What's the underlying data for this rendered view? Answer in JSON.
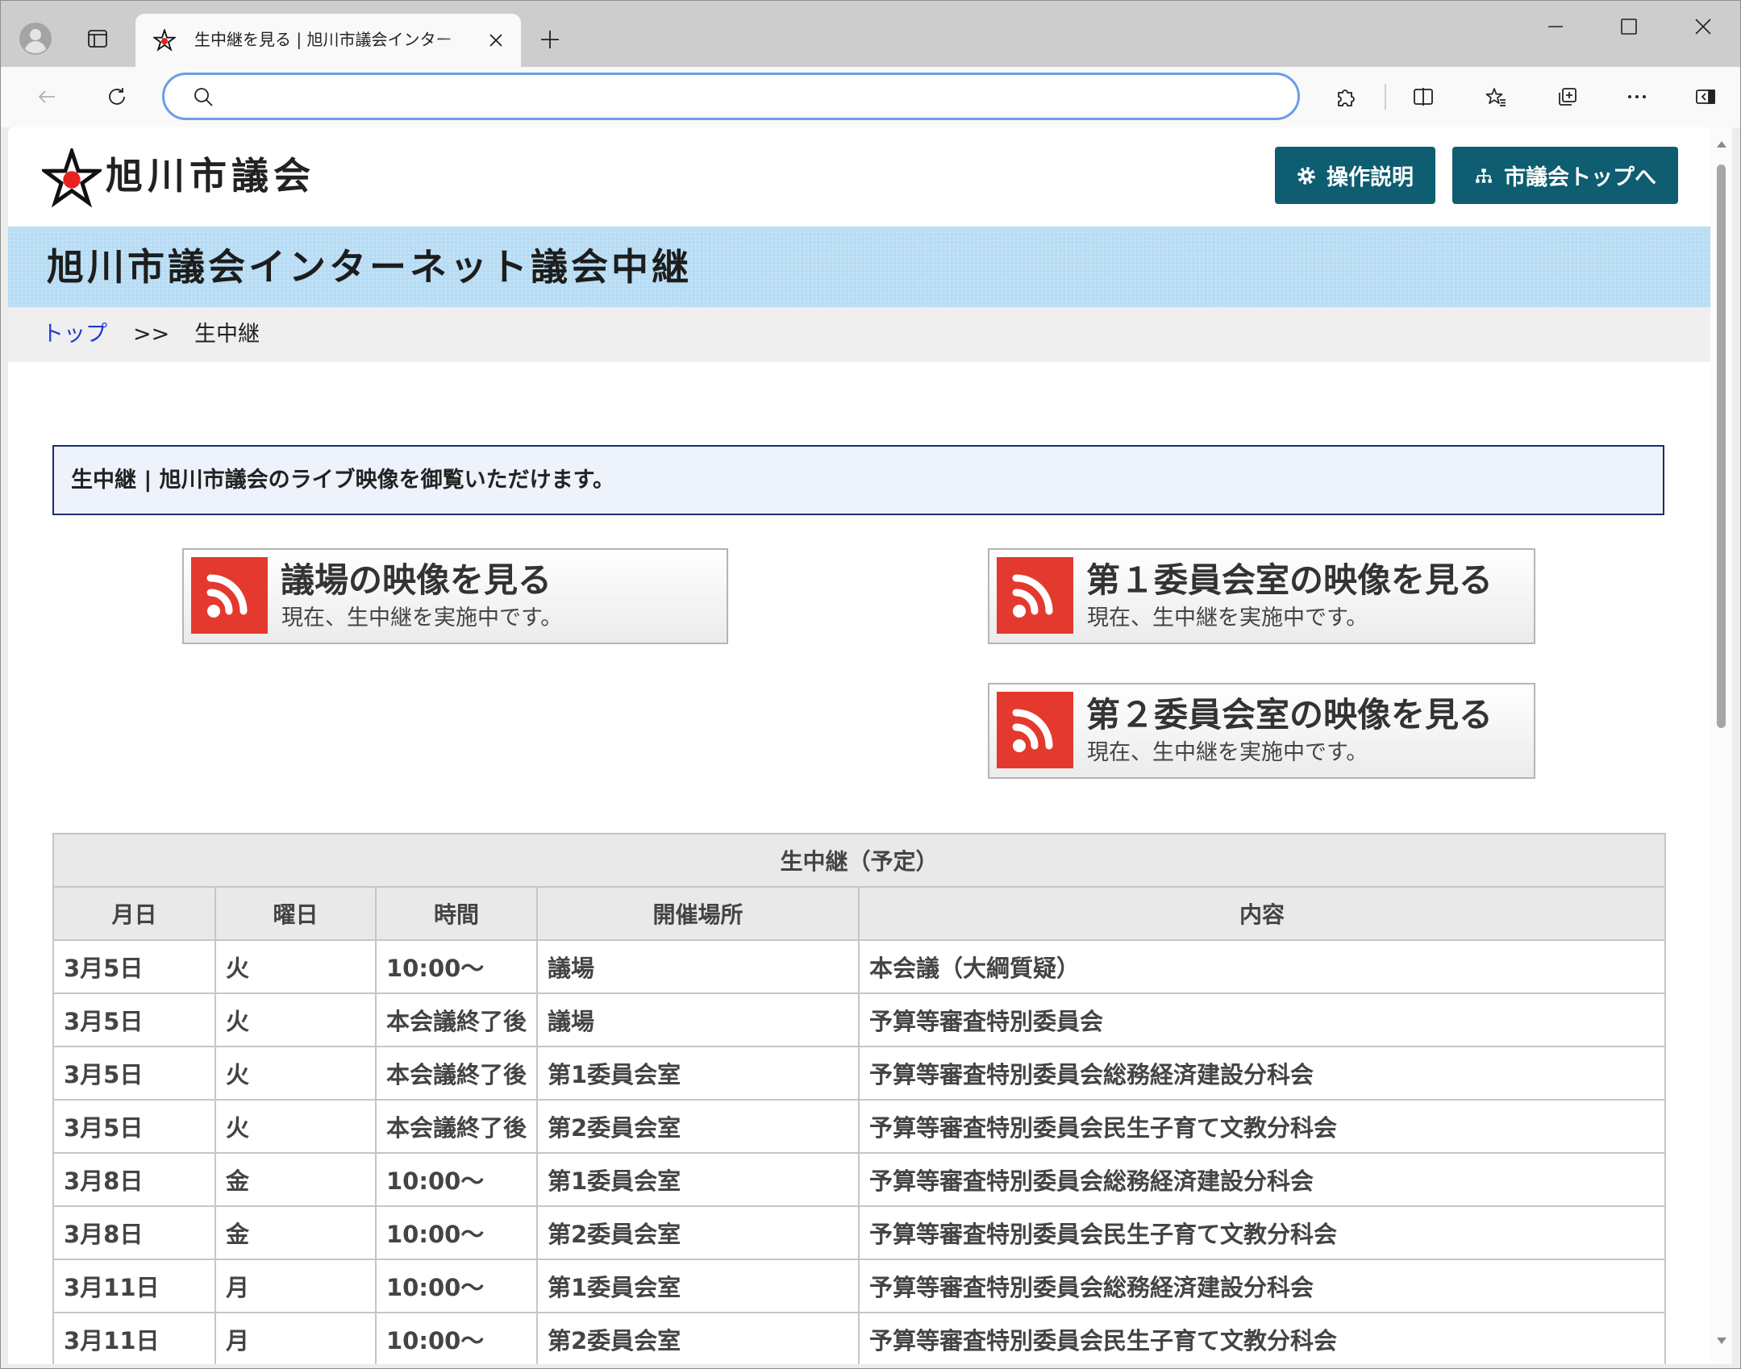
{
  "browser": {
    "tab": {
      "title": "生中継を見る | 旭川市議会インター"
    },
    "address_bar": {
      "value": ""
    }
  },
  "site": {
    "logo_text": "旭川市議会",
    "help_button_label": "操作説明",
    "top_button_label": "市議会トップへ",
    "banner_title": "旭川市議会インターネット議会中継"
  },
  "breadcrumb": {
    "home": "トップ",
    "separator": ">>",
    "current": "生中継"
  },
  "notice": "生中継 | 旭川市議会のライブ映像を御覧いただけます。",
  "live_links": [
    {
      "title": "議場の映像を見る",
      "status": "現在、生中継を実施中です。"
    },
    {
      "title": "第１委員会室の映像を見る",
      "status": "現在、生中継を実施中です。"
    },
    {
      "title": "第２委員会室の映像を見る",
      "status": "現在、生中継を実施中です。"
    }
  ],
  "schedule": {
    "caption": "生中継（予定）",
    "columns": [
      "月日",
      "曜日",
      "時間",
      "開催場所",
      "内容"
    ],
    "rows": [
      [
        "3月5日",
        "火",
        "10:00～",
        "議場",
        "本会議（大綱質疑）"
      ],
      [
        "3月5日",
        "火",
        "本会議終了後",
        "議場",
        "予算等審査特別委員会"
      ],
      [
        "3月5日",
        "火",
        "本会議終了後",
        "第1委員会室",
        "予算等審査特別委員会総務経済建設分科会"
      ],
      [
        "3月5日",
        "火",
        "本会議終了後",
        "第2委員会室",
        "予算等審査特別委員会民生子育て文教分科会"
      ],
      [
        "3月8日",
        "金",
        "10:00～",
        "第1委員会室",
        "予算等審査特別委員会総務経済建設分科会"
      ],
      [
        "3月8日",
        "金",
        "10:00～",
        "第2委員会室",
        "予算等審査特別委員会民生子育て文教分科会"
      ],
      [
        "3月11日",
        "月",
        "10:00～",
        "第1委員会室",
        "予算等審査特別委員会総務経済建設分科会"
      ],
      [
        "3月11日",
        "月",
        "10:00～",
        "第2委員会室",
        "予算等審査特別委員会民生子育て文教分科会"
      ]
    ]
  },
  "colors": {
    "brand": "#0e5d70",
    "banner": "#b7dcf4",
    "link": "#1f3bd1",
    "live_icon": "#e4392e",
    "notice_border": "#1f2d6b",
    "notice_bg": "#eef2fb",
    "table_header": "#e9e9e9"
  },
  "icons": {
    "profile": "avatar-icon",
    "tab_actions": "vertical-tabs-icon",
    "favicon": "star-icon",
    "tab_close": "close-icon",
    "new_tab": "plus-icon",
    "back": "arrow-left-icon",
    "refresh": "refresh-icon",
    "search": "search-icon",
    "extensions": "puzzle-icon",
    "split_screen": "split-screen-icon",
    "favorites": "favorites-star-icon",
    "collections": "collections-icon",
    "more": "more-icon",
    "sidebar": "sidebar-icon",
    "logo": "star-logo-icon",
    "help": "gear-icon",
    "sitemap": "sitemap-icon",
    "live": "rss-icon"
  }
}
